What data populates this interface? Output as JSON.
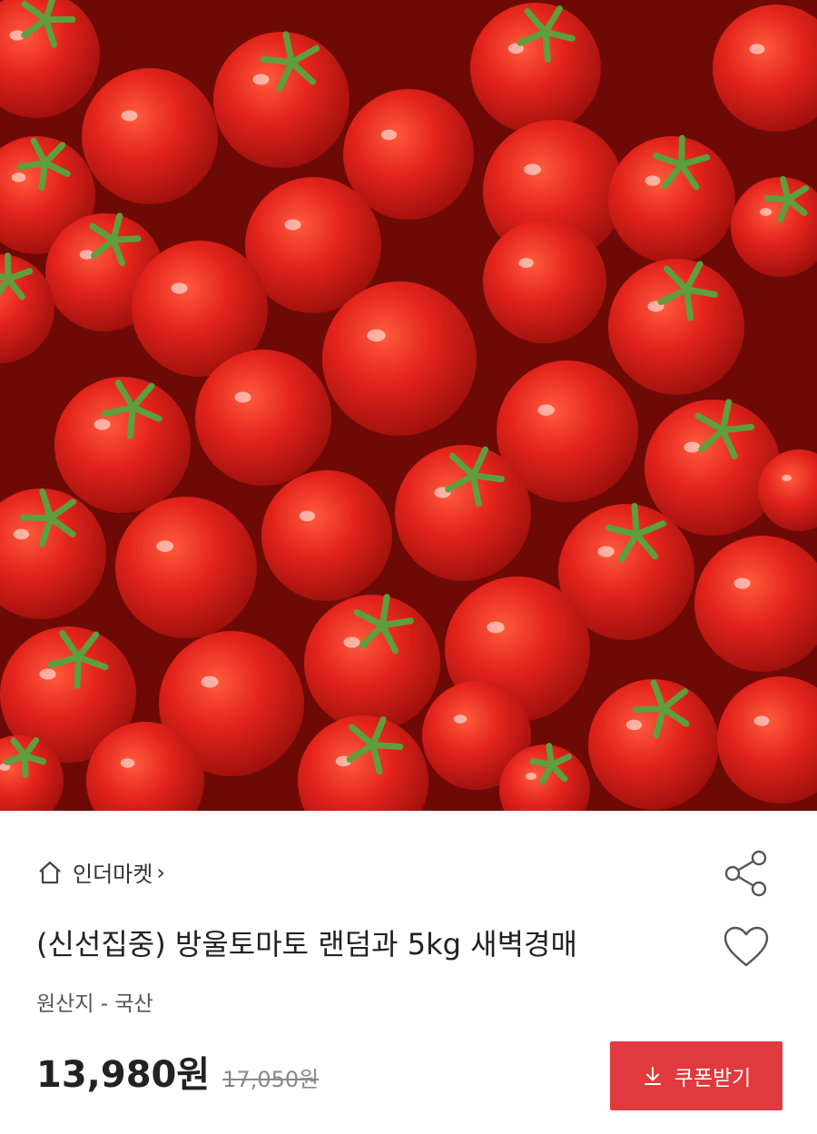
{
  "product_image": {
    "subject": "cherry tomatoes"
  },
  "store": {
    "name": "인더마켓",
    "home_icon": "home-icon",
    "chevron": "›"
  },
  "product": {
    "title": "(신선집중) 방울토마토 랜덤과 5kg 새벽경매",
    "origin": "원산지 - 국산",
    "price": "13,980원",
    "original_price": "17,050원"
  },
  "actions": {
    "share_icon": "share-icon",
    "like_icon": "heart-icon",
    "coupon_label": "쿠폰받기",
    "coupon_icon": "download-icon"
  },
  "colors": {
    "accent": "#e03a3e",
    "tomato": "#e3231c",
    "leaf": "#5e9e3c"
  }
}
